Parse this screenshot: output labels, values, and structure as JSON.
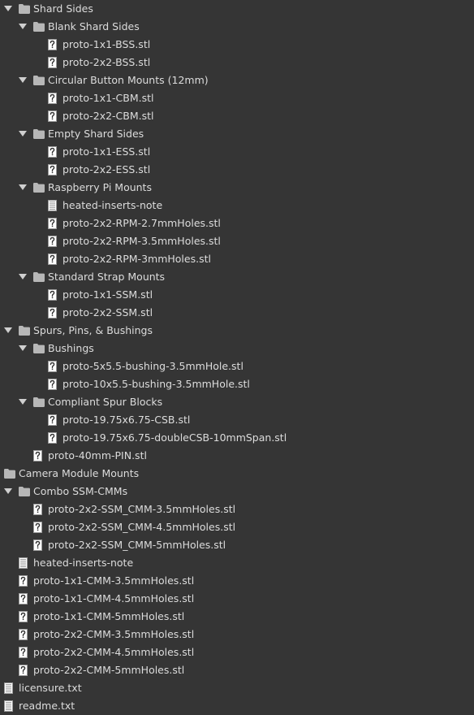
{
  "file_tree": {
    "items": [
      {
        "label": "Shard Sides",
        "type": "folder",
        "depth": 0,
        "expanded": true
      },
      {
        "label": "Blank Shard Sides",
        "type": "folder",
        "depth": 1,
        "expanded": true
      },
      {
        "label": "proto-1x1-BSS.stl",
        "type": "unknown",
        "depth": 2
      },
      {
        "label": "proto-2x2-BSS.stl",
        "type": "unknown",
        "depth": 2
      },
      {
        "label": "Circular Button Mounts (12mm)",
        "type": "folder",
        "depth": 1,
        "expanded": true
      },
      {
        "label": "proto-1x1-CBM.stl",
        "type": "unknown",
        "depth": 2
      },
      {
        "label": "proto-2x2-CBM.stl",
        "type": "unknown",
        "depth": 2
      },
      {
        "label": "Empty Shard Sides",
        "type": "folder",
        "depth": 1,
        "expanded": true
      },
      {
        "label": "proto-1x1-ESS.stl",
        "type": "unknown",
        "depth": 2
      },
      {
        "label": "proto-2x2-ESS.stl",
        "type": "unknown",
        "depth": 2
      },
      {
        "label": "Raspberry Pi Mounts",
        "type": "folder",
        "depth": 1,
        "expanded": true
      },
      {
        "label": "heated-inserts-note",
        "type": "text",
        "depth": 2
      },
      {
        "label": "proto-2x2-RPM-2.7mmHoles.stl",
        "type": "unknown",
        "depth": 2
      },
      {
        "label": "proto-2x2-RPM-3.5mmHoles.stl",
        "type": "unknown",
        "depth": 2
      },
      {
        "label": "proto-2x2-RPM-3mmHoles.stl",
        "type": "unknown",
        "depth": 2
      },
      {
        "label": "Standard Strap Mounts",
        "type": "folder",
        "depth": 1,
        "expanded": true
      },
      {
        "label": "proto-1x1-SSM.stl",
        "type": "unknown",
        "depth": 2
      },
      {
        "label": "proto-2x2-SSM.stl",
        "type": "unknown",
        "depth": 2
      },
      {
        "label": "Spurs, Pins, & Bushings",
        "type": "folder",
        "depth": 0,
        "expanded": true
      },
      {
        "label": "Bushings",
        "type": "folder",
        "depth": 1,
        "expanded": true
      },
      {
        "label": "proto-5x5.5-bushing-3.5mmHole.stl",
        "type": "unknown",
        "depth": 2
      },
      {
        "label": "proto-10x5.5-bushing-3.5mmHole.stl",
        "type": "unknown",
        "depth": 2
      },
      {
        "label": "Compliant Spur Blocks",
        "type": "folder",
        "depth": 1,
        "expanded": true
      },
      {
        "label": "proto-19.75x6.75-CSB.stl",
        "type": "unknown",
        "depth": 2
      },
      {
        "label": "proto-19.75x6.75-doubleCSB-10mmSpan.stl",
        "type": "unknown",
        "depth": 2
      },
      {
        "label": "proto-40mm-PIN.stl",
        "type": "unknown",
        "depth": 1
      },
      {
        "label": "Camera Module Mounts",
        "type": "folder",
        "depth": -1,
        "expanded": null
      },
      {
        "label": "Combo SSM-CMMs",
        "type": "folder",
        "depth": 0,
        "expanded": true
      },
      {
        "label": "proto-2x2-SSM_CMM-3.5mmHoles.stl",
        "type": "unknown",
        "depth": 1
      },
      {
        "label": "proto-2x2-SSM_CMM-4.5mmHoles.stl",
        "type": "unknown",
        "depth": 1
      },
      {
        "label": "proto-2x2-SSM_CMM-5mmHoles.stl",
        "type": "unknown",
        "depth": 1
      },
      {
        "label": "heated-inserts-note",
        "type": "text",
        "depth": 0
      },
      {
        "label": "proto-1x1-CMM-3.5mmHoles.stl",
        "type": "unknown",
        "depth": 0
      },
      {
        "label": "proto-1x1-CMM-4.5mmHoles.stl",
        "type": "unknown",
        "depth": 0
      },
      {
        "label": "proto-1x1-CMM-5mmHoles.stl",
        "type": "unknown",
        "depth": 0
      },
      {
        "label": "proto-2x2-CMM-3.5mmHoles.stl",
        "type": "unknown",
        "depth": 0
      },
      {
        "label": "proto-2x2-CMM-4.5mmHoles.stl",
        "type": "unknown",
        "depth": 0
      },
      {
        "label": "proto-2x2-CMM-5mmHoles.stl",
        "type": "unknown",
        "depth": 0
      },
      {
        "label": "licensure.txt",
        "type": "text",
        "depth": -1
      },
      {
        "label": "readme.txt",
        "type": "text",
        "depth": -1
      }
    ]
  },
  "colors": {
    "background": "#353535",
    "text": "#dcdcdc",
    "folder": "#b7b7b7",
    "arrow": "#cfcfcf",
    "file_icon": "#ffffff"
  }
}
